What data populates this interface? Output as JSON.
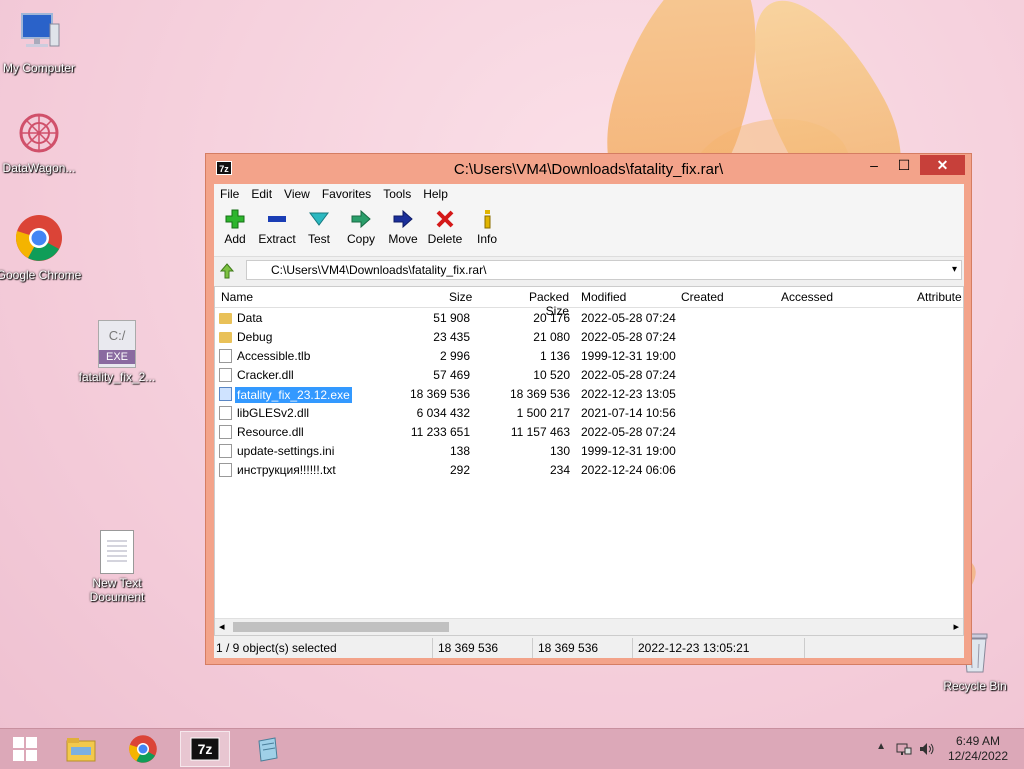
{
  "desktop": {
    "icons": [
      {
        "label": "My Computer"
      },
      {
        "label": "DataWagon..."
      },
      {
        "label": "Google Chrome"
      },
      {
        "label": "fatality_fix_2...",
        "badge": "C:/",
        "sub": "EXE"
      },
      {
        "label": "New Text Document"
      },
      {
        "label": "Recycle Bin"
      }
    ]
  },
  "window": {
    "app_icon": "7z",
    "title": "C:\\Users\\VM4\\Downloads\\fatality_fix.rar\\",
    "controls": {
      "minimize": "–",
      "maximize": "☐",
      "close": "✕"
    },
    "menu": [
      "File",
      "Edit",
      "View",
      "Favorites",
      "Tools",
      "Help"
    ],
    "toolbar": [
      {
        "label": "Add",
        "icon": "add-icon"
      },
      {
        "label": "Extract",
        "icon": "extract-icon"
      },
      {
        "label": "Test",
        "icon": "test-icon"
      },
      {
        "label": "Copy",
        "icon": "copy-icon"
      },
      {
        "label": "Move",
        "icon": "move-icon"
      },
      {
        "label": "Delete",
        "icon": "delete-icon"
      },
      {
        "label": "Info",
        "icon": "info-icon"
      }
    ],
    "address": "C:\\Users\\VM4\\Downloads\\fatality_fix.rar\\",
    "columns": [
      "Name",
      "Size",
      "Packed Size",
      "Modified",
      "Created",
      "Accessed",
      "Attribute"
    ],
    "files": [
      {
        "name": "Data",
        "size": "51 908",
        "packed": "20 176",
        "modified": "2022-05-28 07:24",
        "type": "folder"
      },
      {
        "name": "Debug",
        "size": "23 435",
        "packed": "21 080",
        "modified": "2022-05-28 07:24",
        "type": "folder"
      },
      {
        "name": "Accessible.tlb",
        "size": "2 996",
        "packed": "1 136",
        "modified": "1999-12-31 19:00",
        "type": "doc"
      },
      {
        "name": "Cracker.dll",
        "size": "57 469",
        "packed": "10 520",
        "modified": "2022-05-28 07:24",
        "type": "dll"
      },
      {
        "name": "fatality_fix_23.12.exe",
        "size": "18 369 536",
        "packed": "18 369 536",
        "modified": "2022-12-23 13:05",
        "type": "exe",
        "selected": true
      },
      {
        "name": "libGLESv2.dll",
        "size": "6 034 432",
        "packed": "1 500 217",
        "modified": "2021-07-14 10:56",
        "type": "dll"
      },
      {
        "name": "Resource.dll",
        "size": "11 233 651",
        "packed": "11 157 463",
        "modified": "2022-05-28 07:24",
        "type": "dll"
      },
      {
        "name": "update-settings.ini",
        "size": "138",
        "packed": "130",
        "modified": "1999-12-31 19:00",
        "type": "dll"
      },
      {
        "name": "инструкция!!!!!!.txt",
        "size": "292",
        "packed": "234",
        "modified": "2022-12-24 06:06",
        "type": "doc"
      }
    ],
    "status": {
      "selection": "1 / 9 object(s) selected",
      "size": "18 369 536",
      "packed": "18 369 536",
      "modified": "2022-12-23 13:05:21"
    }
  },
  "taskbar": {
    "clock_time": "6:49 AM",
    "clock_date": "12/24/2022"
  }
}
